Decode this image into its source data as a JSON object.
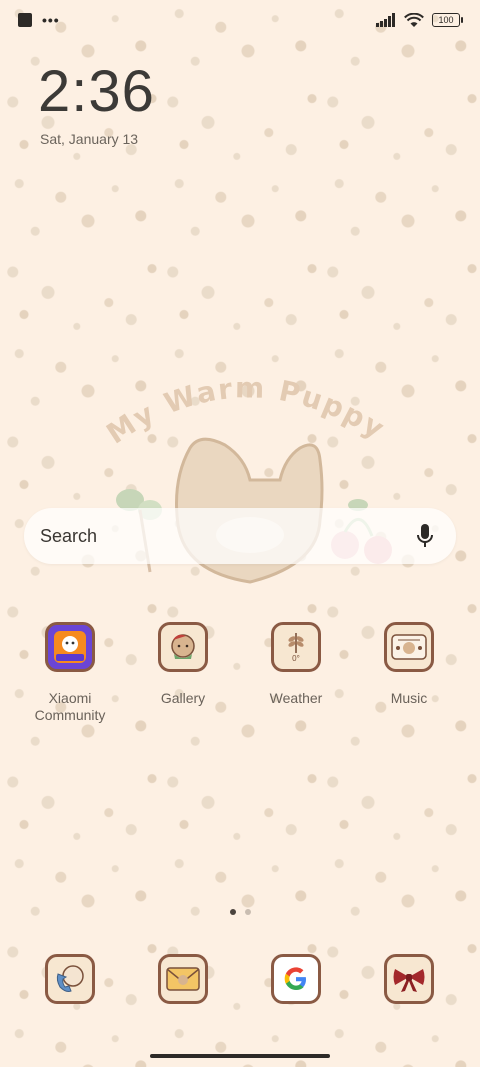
{
  "status_bar": {
    "battery": "100"
  },
  "clock": {
    "time": "2:36",
    "date": "Sat, January 13"
  },
  "wallpaper": {
    "title": "My Warm Puppy"
  },
  "search": {
    "label": "Search"
  },
  "apps": [
    {
      "label": "Xiaomi Community",
      "icon": "xiaomi-community-icon"
    },
    {
      "label": "Gallery",
      "icon": "gallery-icon"
    },
    {
      "label": "Weather",
      "icon": "weather-icon",
      "temp": "0°"
    },
    {
      "label": "Music",
      "icon": "music-icon"
    }
  ],
  "dock": [
    {
      "icon": "phone-icon"
    },
    {
      "icon": "messages-icon"
    },
    {
      "icon": "google-icon"
    },
    {
      "icon": "bow-icon"
    }
  ],
  "pages": {
    "count": 2,
    "active": 1
  },
  "colors": {
    "background": "#fdf0e3",
    "icon_border": "#8a5a44",
    "icon_fill": "#f7e7d1"
  }
}
